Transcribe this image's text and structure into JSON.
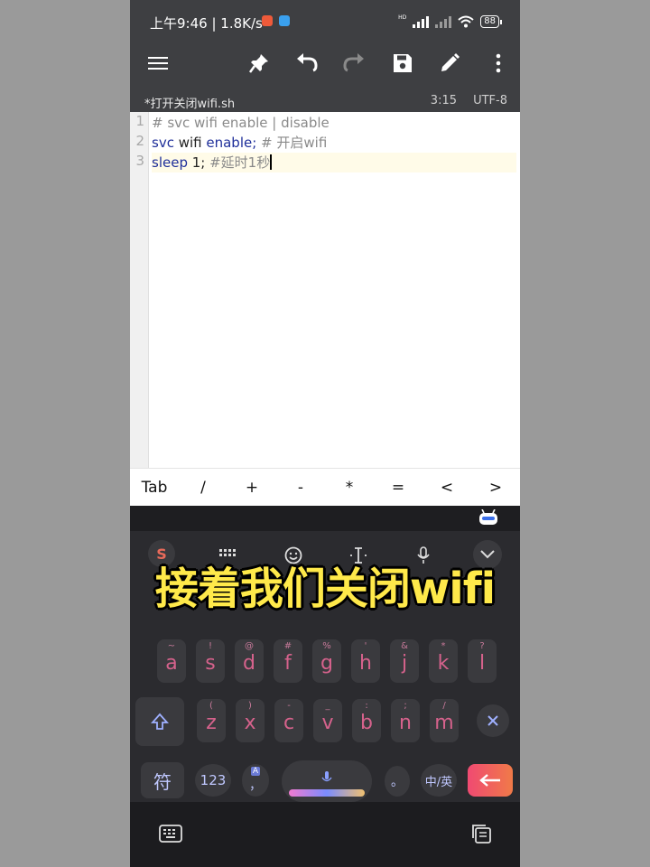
{
  "status_bar": {
    "time": "上午9:46 | 1.8K/s",
    "battery": "88",
    "hd_label": "HD"
  },
  "toolbar": {
    "icons": [
      "menu-icon",
      "pin-icon",
      "undo-icon",
      "redo-icon",
      "save-icon",
      "edit-icon",
      "more-icon"
    ]
  },
  "file": {
    "name": "*打开关闭wifi.sh",
    "position": "3:15",
    "encoding": "UTF-8"
  },
  "editor": {
    "line_numbers": [
      "1",
      "2",
      "3"
    ],
    "lines": [
      {
        "parts": [
          {
            "text": "# svc wifi enable | disable",
            "cls": "c-comment"
          }
        ]
      },
      {
        "parts": [
          {
            "text": "svc ",
            "cls": "c-kw"
          },
          {
            "text": "wifi ",
            "cls": "c-plain"
          },
          {
            "text": "enable; ",
            "cls": "c-kw"
          },
          {
            "text": "# 开启wifi",
            "cls": "c-comment"
          }
        ]
      },
      {
        "parts": [
          {
            "text": "sleep ",
            "cls": "c-kw"
          },
          {
            "text": "1; ",
            "cls": "c-plain"
          },
          {
            "text": "#延时1秒",
            "cls": "c-comment"
          }
        ]
      }
    ],
    "active_line": 3
  },
  "symbol_bar": [
    "Tab",
    "/",
    "+",
    "-",
    "*",
    "=",
    "<",
    ">"
  ],
  "keyboard": {
    "row_middle": [
      {
        "main": "a",
        "sub": "~"
      },
      {
        "main": "s",
        "sub": "!"
      },
      {
        "main": "d",
        "sub": "@"
      },
      {
        "main": "f",
        "sub": "#"
      },
      {
        "main": "g",
        "sub": "%"
      },
      {
        "main": "h",
        "sub": "'"
      },
      {
        "main": "j",
        "sub": "&"
      },
      {
        "main": "k",
        "sub": "*"
      },
      {
        "main": "l",
        "sub": "?"
      }
    ],
    "row_bottom": [
      {
        "main": "z",
        "sub": "("
      },
      {
        "main": "x",
        "sub": ")"
      },
      {
        "main": "c",
        "sub": "-"
      },
      {
        "main": "v",
        "sub": "_"
      },
      {
        "main": "b",
        "sub": ":"
      },
      {
        "main": "n",
        "sub": ";"
      },
      {
        "main": "m",
        "sub": "/"
      }
    ],
    "symbols_key": "符",
    "numbers_key": "123",
    "comma_key": "，",
    "period_key": "。",
    "lang_key": "中/英",
    "small_letter": "A"
  },
  "caption": "接着我们关闭wifi",
  "colors": {
    "toolbar_bg": "#3e3f42",
    "keyboard_bg": "#2b2b2f",
    "key_text": "#d6628c",
    "enter_key": "#f0506e",
    "caption": "#ffe94a"
  }
}
